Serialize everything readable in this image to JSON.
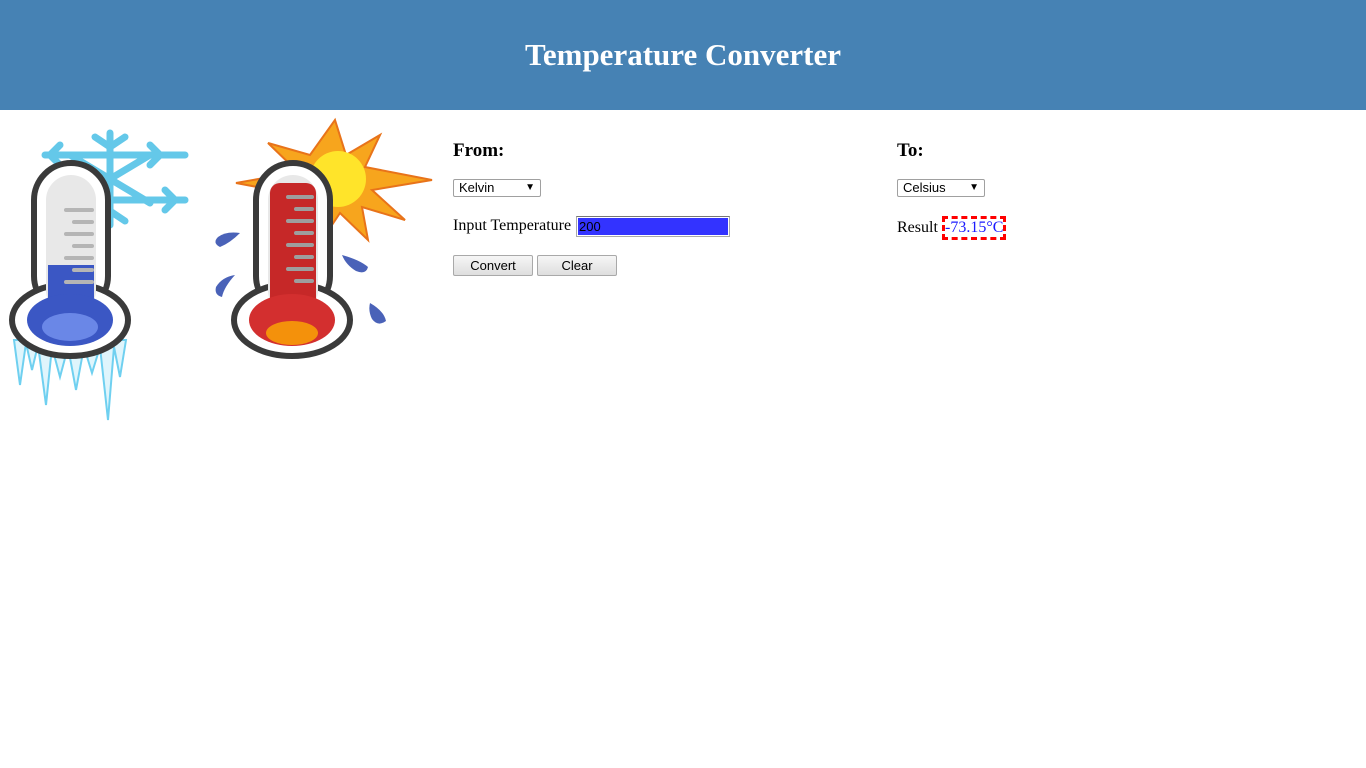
{
  "header": {
    "title": "Temperature Converter",
    "background": "#4682b4"
  },
  "illustrations": {
    "cold_icon": "cold-thermometer-snowflake-icon",
    "hot_icon": "hot-thermometer-sun-icon"
  },
  "from": {
    "label": "From:",
    "unit_selected": "Kelvin",
    "input_label": "Input Temperature",
    "input_value": "200"
  },
  "to": {
    "label": "To:",
    "unit_selected": "Celsius",
    "result_label": "Result",
    "result_value": "-73.15°C"
  },
  "buttons": {
    "convert": "Convert",
    "clear": "Clear"
  },
  "colors": {
    "input_highlight": "#3333ff",
    "result_border": "#ff0000",
    "result_text": "#1a1aff"
  }
}
